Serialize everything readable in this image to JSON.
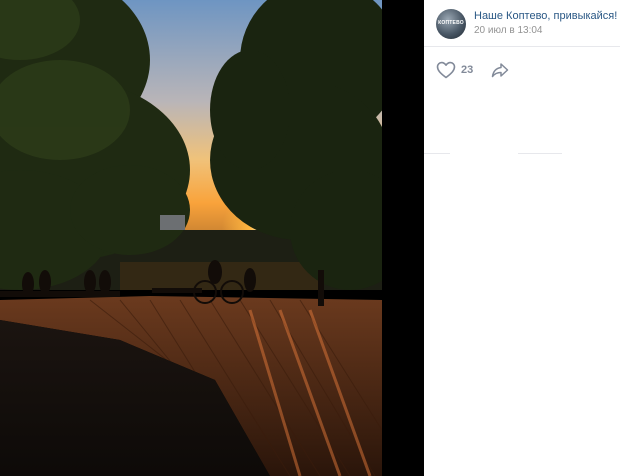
{
  "post": {
    "author_name": "Наше Коптево, привыкайся!",
    "date": "20 июл в 13:04",
    "avatar_text": "КОПТЕВО",
    "likes": "23"
  },
  "icons": {
    "like": "heart-icon",
    "share": "share-arrow-icon"
  },
  "colors": {
    "link": "#2a5885",
    "muted": "#939393",
    "sunset": "#f6a23a"
  }
}
